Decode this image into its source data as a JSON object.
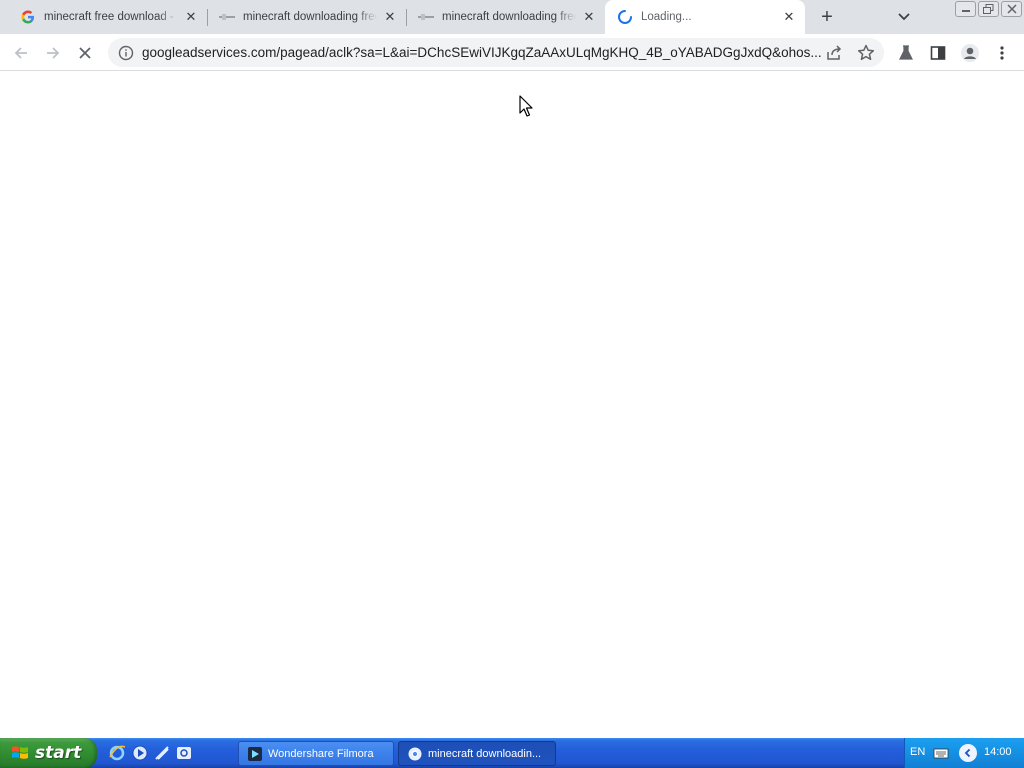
{
  "browser": {
    "tabs": [
      {
        "title": "minecraft free download - Google Search",
        "favicon": "google-g-icon"
      },
      {
        "title": "minecraft downloading free",
        "favicon": "site-icon"
      },
      {
        "title": "minecraft downloading free",
        "favicon": "site-icon"
      },
      {
        "title": "Loading...",
        "favicon": "loading-spinner-icon",
        "active": true
      }
    ],
    "close_glyph": "✕",
    "new_tab_glyph": "+",
    "url": "googleadservices.com/pagead/aclk?sa=L&ai=DChcSEwiVIJKgqZaAAxULqMgKHQ_4B_oYABADGgJxdQ&ohos...",
    "page_title_loading": "Loading..."
  },
  "taskbar": {
    "start_label": "start",
    "tasks": [
      {
        "label": "Wondershare Filmora",
        "icon": "filmora-icon"
      },
      {
        "label": "minecraft downloadin...",
        "icon": "chrome-icon"
      }
    ],
    "tray": {
      "language": "EN",
      "time": "14:00"
    }
  },
  "colors": {
    "tabstrip": "#dee1e6",
    "omnibox": "#f1f3f4",
    "taskbar_blue": "#245edb",
    "start_green": "#3c9a3c"
  }
}
